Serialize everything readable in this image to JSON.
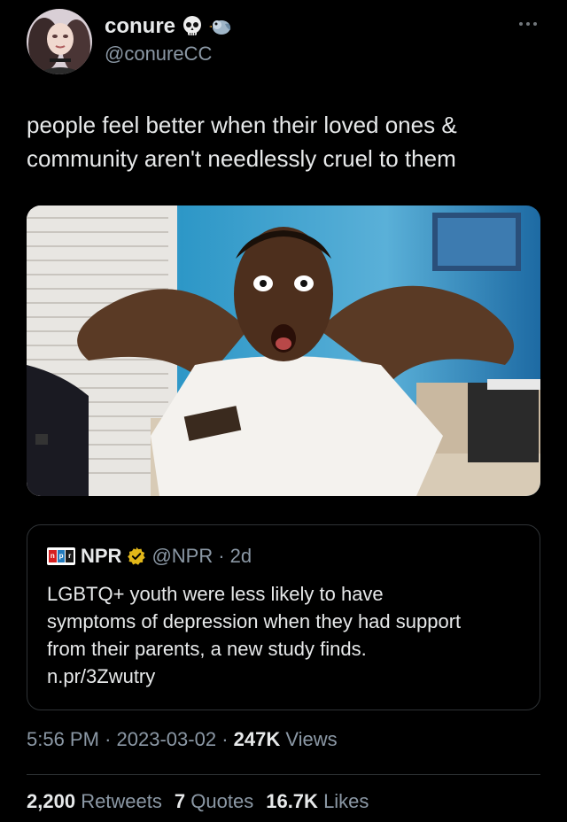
{
  "author": {
    "name": "conure",
    "handle": "@conureCC",
    "badges": [
      "skull-emoji",
      "bird-emoji"
    ]
  },
  "tweet": {
    "text": "people feel better when their loved ones &\ncommunity aren't needlessly cruel to them"
  },
  "media": {
    "icon": "photo-media"
  },
  "quote": {
    "logo_letters": [
      "n",
      "p",
      "r"
    ],
    "logo_colors": [
      "#d62021",
      "#237bbd",
      "#1a1a1a"
    ],
    "name": "NPR",
    "handle": "@NPR",
    "separator": "·",
    "age": "2d",
    "text": "LGBTQ+ youth were less likely to have\nsymptoms of depression when they had support\nfrom their parents, a new study finds.\nn.pr/3Zwutry"
  },
  "meta": {
    "time": "5:56 PM",
    "separator": "·",
    "date": "2023-03-02",
    "views_count": "247K",
    "views_label": "Views"
  },
  "stats": {
    "retweets_count": "2,200",
    "retweets_label": "Retweets",
    "quotes_count": "7",
    "quotes_label": "Quotes",
    "likes_count": "16.7K",
    "likes_label": "Likes"
  },
  "colors": {
    "background": "#000000",
    "text": "#e7e9ea",
    "muted": "#8b98a5",
    "border": "#2f3336",
    "verified_gold": "#e2b719"
  }
}
